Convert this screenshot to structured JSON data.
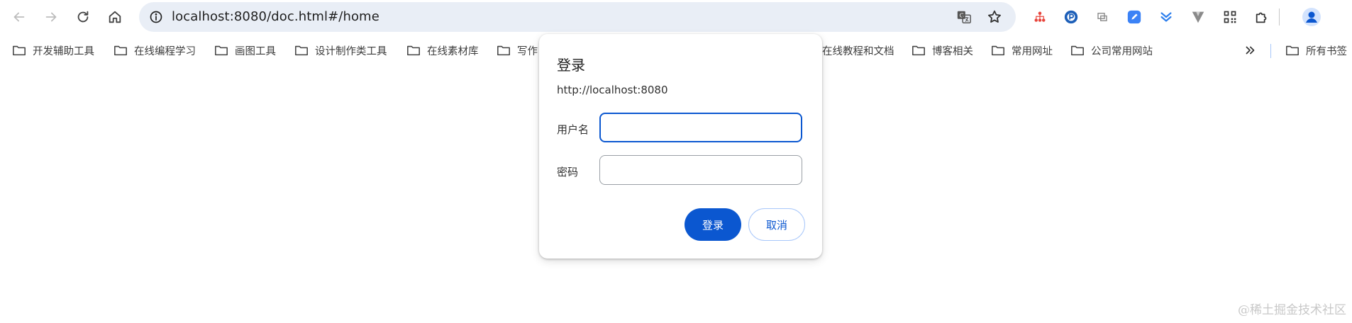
{
  "toolbar": {
    "back_icon": "arrow-left-icon",
    "forward_icon": "arrow-right-icon",
    "reload_icon": "reload-icon",
    "home_icon": "home-icon",
    "url": "localhost:8080/doc.html#/home",
    "info_icon": "info-icon",
    "translate_icon": "translate-icon",
    "bookmark_star_icon": "star-icon",
    "extensions": [
      "sitemap-icon",
      "circle-p-icon",
      "screen-icon",
      "pen-icon",
      "chevrons-down-icon",
      "v-icon",
      "qr-icon",
      "puzzle-icon"
    ],
    "profile_icon": "profile-icon"
  },
  "bookmarks": {
    "items": [
      "开发辅助工具",
      "在线编程学习",
      "画图工具",
      "设计制作类工具",
      "在线素材库",
      "写作",
      "在线教程和文档",
      "博客相关",
      "常用网址",
      "公司常用网站"
    ],
    "overflow_icon": "double-chevron-right-icon",
    "all_bookmarks": "所有书签"
  },
  "dialog": {
    "title": "登录",
    "origin": "http://localhost:8080",
    "username_label": "用户名",
    "username_value": "",
    "password_label": "密码",
    "password_value": "",
    "login_button": "登录",
    "cancel_button": "取消"
  },
  "watermark": "@稀土掘金技术社区",
  "colors": {
    "accent": "#0b57d0",
    "omnibox_bg": "#e9eef6"
  }
}
